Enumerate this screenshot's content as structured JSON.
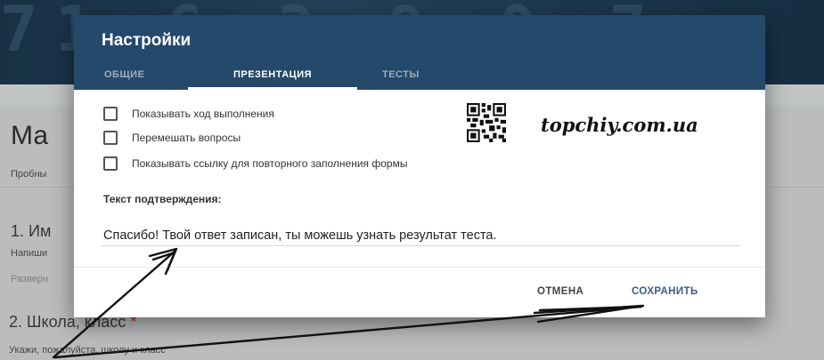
{
  "background": {
    "banner_digits": "71  6  3  9  0  7",
    "form_title": "Ма",
    "form_description": "Пробны",
    "question1": {
      "title": "1. Им",
      "hint": "Напиши",
      "input_placeholder": "Разверн"
    },
    "question2": {
      "title": "2. Школа, класс",
      "required_mark": "*",
      "hint": "Укажи, пожалуйста, школу и класс"
    }
  },
  "dialog": {
    "title": "Настройки",
    "tabs": [
      {
        "label": "ОБЩИЕ",
        "active": false
      },
      {
        "label": "ПРЕЗЕНТАЦИЯ",
        "active": true
      },
      {
        "label": "ТЕСТЫ",
        "active": false
      }
    ],
    "options": [
      {
        "label": "Показывать ход выполнения",
        "checked": false
      },
      {
        "label": "Перемешать вопросы",
        "checked": false
      },
      {
        "label": "Показывать ссылку для повторного заполнения формы",
        "checked": false
      }
    ],
    "confirmation_label": "Текст подтверждения:",
    "confirmation_text": "Спасибо! Твой ответ записан, ты можешь узнать результат теста.",
    "cancel_label": "ОТМЕНА",
    "save_label": "СОХРАНИТЬ"
  },
  "watermark": {
    "text": "topchiy.com.ua"
  },
  "colors": {
    "header": "#24496b",
    "accent": "#3a5d85"
  }
}
